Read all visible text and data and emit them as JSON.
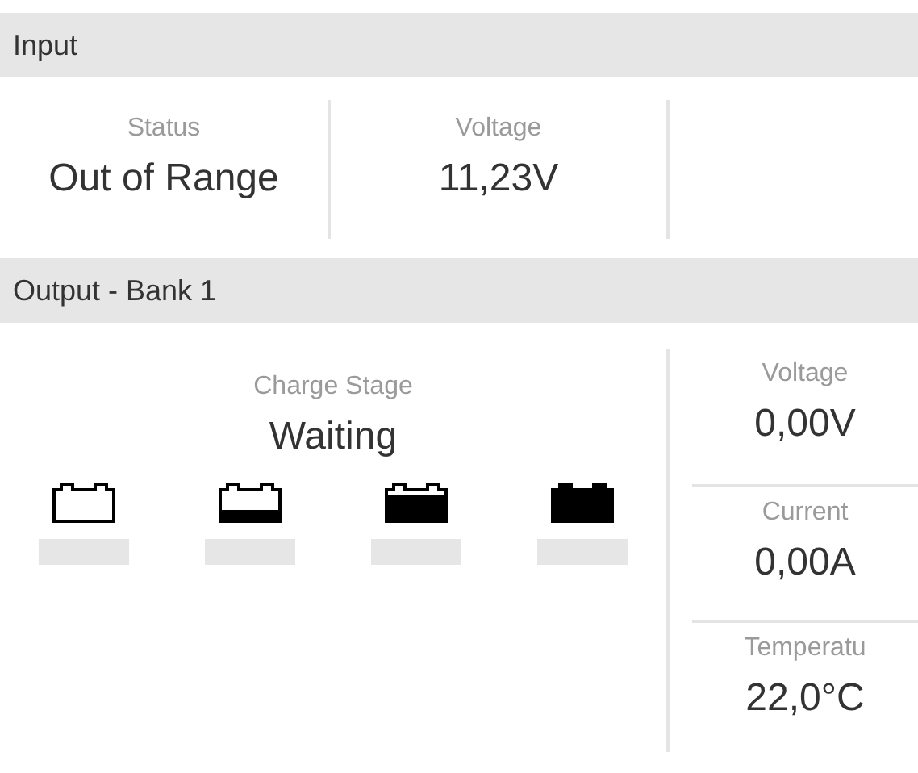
{
  "input": {
    "title": "Input",
    "fields": [
      {
        "label": "Status",
        "value": "Out of Range"
      },
      {
        "label": "Voltage",
        "value": "11,23V"
      }
    ]
  },
  "output": {
    "title": "Output - Bank 1",
    "charge_stage": {
      "label": "Charge Stage",
      "value": "Waiting",
      "stages": [
        {
          "kind": "empty",
          "active": false
        },
        {
          "kind": "low",
          "active": false
        },
        {
          "kind": "high",
          "active": false
        },
        {
          "kind": "full",
          "active": false
        }
      ]
    },
    "readings": [
      {
        "label": "Voltage",
        "value": "0,00V"
      },
      {
        "label": "Current",
        "value": "0,00A"
      },
      {
        "label": "Temperatu",
        "value": "22,0°C"
      }
    ]
  }
}
